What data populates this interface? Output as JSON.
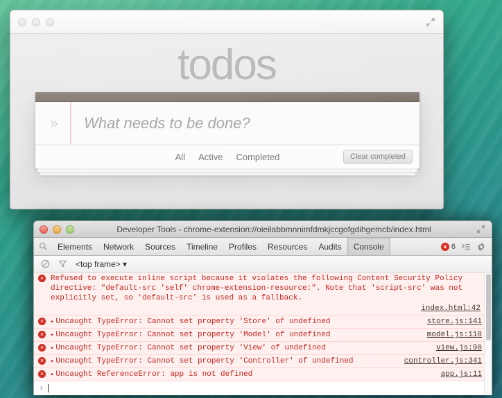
{
  "desktop": {
    "wallpaper_name": "os-x-mavericks-wave",
    "colors": {
      "top": "#4fbf8f",
      "bottom": "#24798a"
    }
  },
  "todos_window": {
    "traffic_lights": [
      {
        "name": "close",
        "state": "inactive"
      },
      {
        "name": "minimize",
        "state": "inactive"
      },
      {
        "name": "zoom",
        "state": "inactive"
      }
    ],
    "expand_icon": "fullscreen-expand-icon",
    "title": "todos",
    "toggle_all_glyph": "»",
    "new_todo": {
      "value": "",
      "placeholder": "What needs to be done?"
    },
    "filters": [
      {
        "label": "All",
        "selected": false
      },
      {
        "label": "Active",
        "selected": false
      },
      {
        "label": "Completed",
        "selected": false
      }
    ],
    "clear_completed_label": "Clear completed"
  },
  "devtools": {
    "traffic_lights": [
      {
        "name": "close",
        "state": "active"
      },
      {
        "name": "minimize",
        "state": "active"
      },
      {
        "name": "zoom",
        "state": "active"
      }
    ],
    "title": "Developer Tools - chrome-extension://oieilabbmnnimfdmkjccgofgdihgemcb/index.html",
    "expand_icon": "fullscreen-expand-icon",
    "tabs": [
      {
        "label": "Elements",
        "active": false
      },
      {
        "label": "Network",
        "active": false
      },
      {
        "label": "Sources",
        "active": false
      },
      {
        "label": "Timeline",
        "active": false
      },
      {
        "label": "Profiles",
        "active": false
      },
      {
        "label": "Resources",
        "active": false
      },
      {
        "label": "Audits",
        "active": false
      },
      {
        "label": "Console",
        "active": true
      }
    ],
    "error_count": "6",
    "error_badge_glyph": "×",
    "search_icon": "search-icon",
    "drawer_icon": "show-drawer-icon",
    "gear_icon": "settings-gear-icon",
    "console_toolbar": {
      "clear_icon": "clear-console-icon",
      "filter_icon": "filter-funnel-icon",
      "frame_selector": "<top frame> ▾"
    },
    "console_messages": [
      {
        "level": "error",
        "expandable": false,
        "text": "Refused to execute inline script because it violates the following Content Security Policy directive: \"default-src 'self' chrome-extension-resource:\". Note that 'script-src' was not explicitly set, so 'default-src' is used as a fallback.",
        "source": "index.html:42",
        "multiline": true
      },
      {
        "level": "error",
        "expandable": true,
        "text": "Uncaught TypeError: Cannot set property 'Store' of undefined",
        "source": "store.js:141",
        "multiline": false
      },
      {
        "level": "error",
        "expandable": true,
        "text": "Uncaught TypeError: Cannot set property 'Model' of undefined",
        "source": "model.js:118",
        "multiline": false
      },
      {
        "level": "error",
        "expandable": true,
        "text": "Uncaught TypeError: Cannot set property 'View' of undefined",
        "source": "view.js:90",
        "multiline": false
      },
      {
        "level": "error",
        "expandable": true,
        "text": "Uncaught TypeError: Cannot set property 'Controller' of undefined",
        "source": "controller.js:341",
        "multiline": false
      },
      {
        "level": "error",
        "expandable": true,
        "text": "Uncaught ReferenceError: app is not defined",
        "source": "app.js:11",
        "multiline": false
      }
    ],
    "prompt": {
      "chevron": "›",
      "value": ""
    }
  }
}
